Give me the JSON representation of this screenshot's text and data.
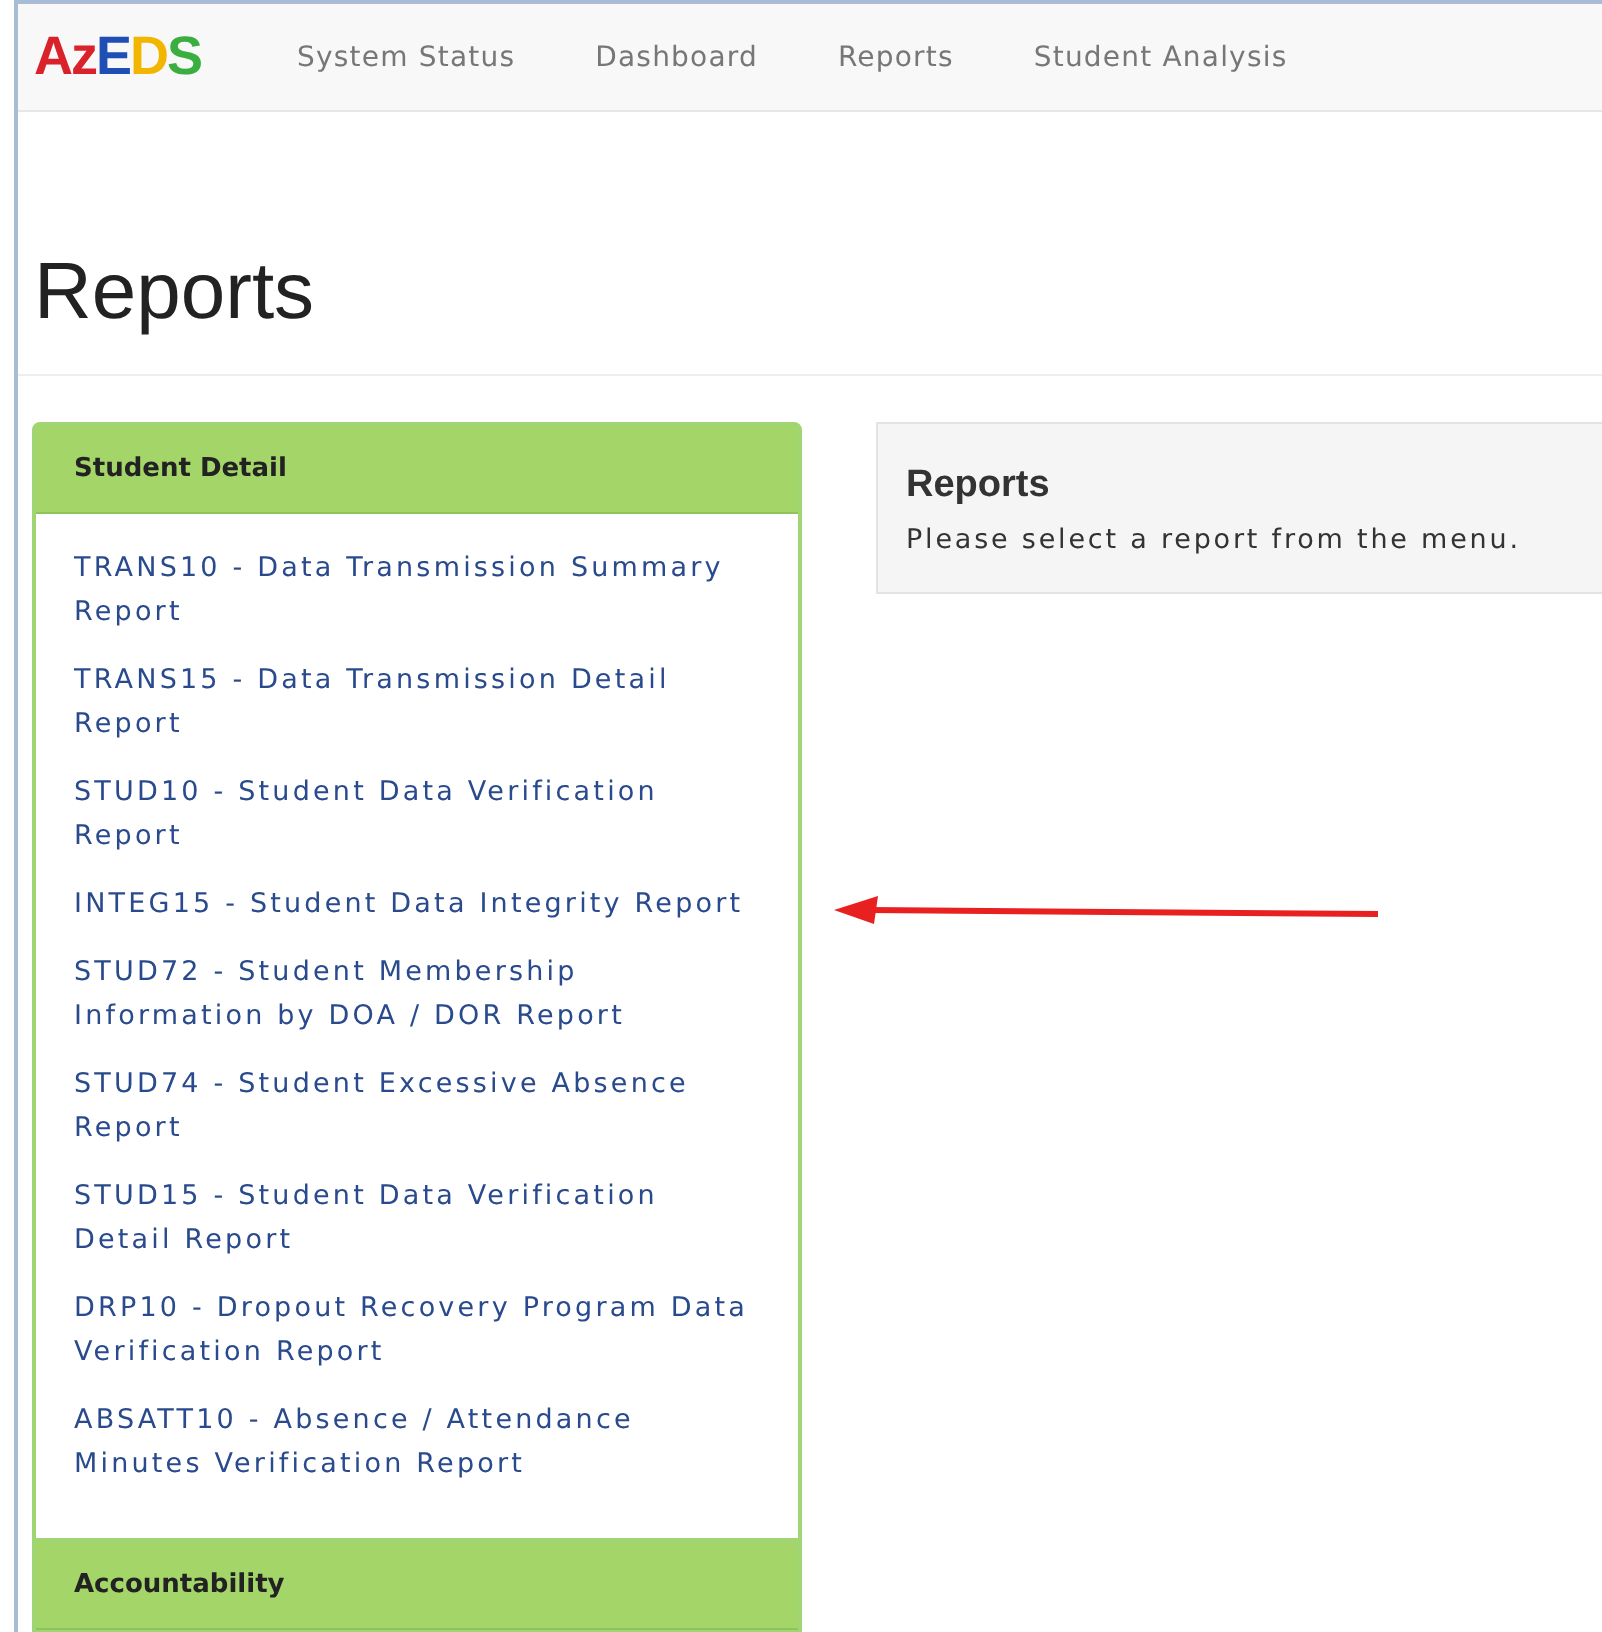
{
  "navbar": {
    "logo": [
      {
        "text": "Az",
        "color": "#d9222a"
      },
      {
        "text": "E",
        "color": "#1f4fb4"
      },
      {
        "text": "D",
        "color": "#f2b600"
      },
      {
        "text": "S",
        "color": "#3aae3f"
      }
    ],
    "items": [
      {
        "label": "System Status"
      },
      {
        "label": "Dashboard"
      },
      {
        "label": "Reports"
      },
      {
        "label": "Student Analysis"
      }
    ]
  },
  "page_title": "Reports",
  "sidebar": {
    "panels": [
      {
        "heading": "Student Detail",
        "links": [
          "TRANS10 - Data Transmission Summary Report",
          "TRANS15 - Data Transmission Detail Report",
          "STUD10 - Student Data Verification Report",
          "INTEG15 - Student Data Integrity Report",
          "STUD72 - Student Membership Information by DOA / DOR Report",
          "STUD74 - Student Excessive Absence Report",
          "STUD15 - Student Data Verification Detail Report",
          "DRP10 - Dropout Recovery Program Data Verification Report",
          "ABSATT10 - Absence / Attendance Minutes Verification Report"
        ]
      },
      {
        "heading": "Accountability"
      }
    ]
  },
  "content": {
    "heading": "Reports",
    "message": "Please select a report from the menu."
  }
}
